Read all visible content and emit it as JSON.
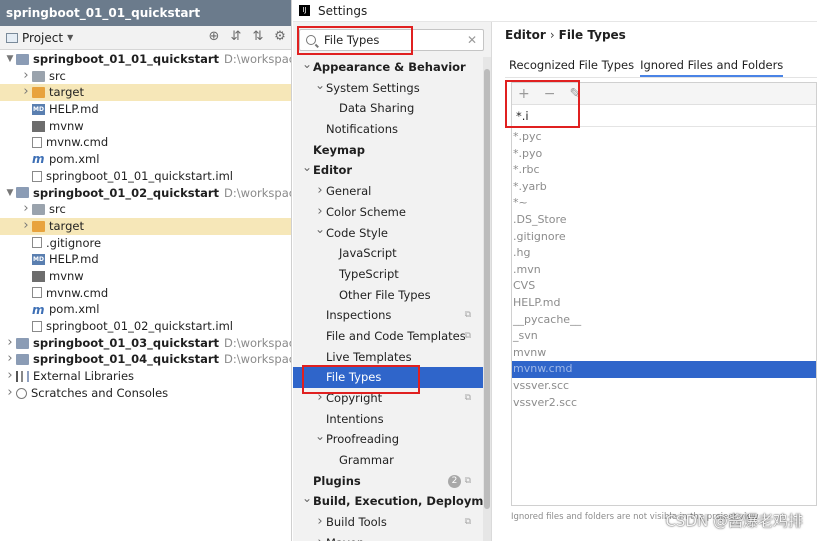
{
  "project_panel": {
    "title": "springboot_01_01_quickstart",
    "toolbar_label": "Project",
    "tree": [
      {
        "indent": 0,
        "arrow": "v",
        "icon": "module",
        "label": "springboot_01_01_quickstart",
        "bold": true,
        "path": "D:\\workspace\\spri"
      },
      {
        "indent": 1,
        "arrow": ">",
        "icon": "folder",
        "label": "src"
      },
      {
        "indent": 1,
        "arrow": ">",
        "icon": "folder-orange",
        "label": "target",
        "highlight": true
      },
      {
        "indent": 1,
        "arrow": "",
        "icon": "md",
        "label": "HELP.md"
      },
      {
        "indent": 1,
        "arrow": "",
        "icon": "mvnw",
        "label": "mvnw"
      },
      {
        "indent": 1,
        "arrow": "",
        "icon": "file",
        "label": "mvnw.cmd"
      },
      {
        "indent": 1,
        "arrow": "",
        "icon": "pom",
        "label": "pom.xml"
      },
      {
        "indent": 1,
        "arrow": "",
        "icon": "file",
        "label": "springboot_01_01_quickstart.iml"
      },
      {
        "indent": 0,
        "arrow": "v",
        "icon": "module",
        "label": "springboot_01_02_quickstart",
        "bold": true,
        "path": "D:\\workspace\\spri"
      },
      {
        "indent": 1,
        "arrow": ">",
        "icon": "folder",
        "label": "src"
      },
      {
        "indent": 1,
        "arrow": ">",
        "icon": "folder-orange",
        "label": "target",
        "highlight": true
      },
      {
        "indent": 1,
        "arrow": "",
        "icon": "file",
        "label": ".gitignore"
      },
      {
        "indent": 1,
        "arrow": "",
        "icon": "md",
        "label": "HELP.md"
      },
      {
        "indent": 1,
        "arrow": "",
        "icon": "mvnw",
        "label": "mvnw"
      },
      {
        "indent": 1,
        "arrow": "",
        "icon": "file",
        "label": "mvnw.cmd"
      },
      {
        "indent": 1,
        "arrow": "",
        "icon": "pom",
        "label": "pom.xml"
      },
      {
        "indent": 1,
        "arrow": "",
        "icon": "file",
        "label": "springboot_01_02_quickstart.iml"
      },
      {
        "indent": 0,
        "arrow": ">",
        "icon": "module",
        "label": "springboot_01_03_quickstart",
        "bold": true,
        "path": "D:\\workspace\\spri"
      },
      {
        "indent": 0,
        "arrow": ">",
        "icon": "module",
        "label": "springboot_01_04_quickstart",
        "bold": true,
        "path": "D:\\workspace\\spri"
      },
      {
        "indent": 0,
        "arrow": ">",
        "icon": "lib",
        "label": "External Libraries"
      },
      {
        "indent": 0,
        "arrow": ">",
        "icon": "scratch",
        "label": "Scratches and Consoles"
      }
    ]
  },
  "settings": {
    "title": "Settings",
    "search_value": "File Types",
    "nav": [
      {
        "indent": 0,
        "arrow": "v",
        "label": "Appearance & Behavior",
        "bold": true
      },
      {
        "indent": 1,
        "arrow": "v",
        "label": "System Settings"
      },
      {
        "indent": 2,
        "arrow": "",
        "label": "Data Sharing"
      },
      {
        "indent": 1,
        "arrow": "",
        "label": "Notifications"
      },
      {
        "indent": 0,
        "arrow": "",
        "label": "Keymap",
        "bold": true
      },
      {
        "indent": 0,
        "arrow": "v",
        "label": "Editor",
        "bold": true
      },
      {
        "indent": 1,
        "arrow": ">",
        "label": "General"
      },
      {
        "indent": 1,
        "arrow": ">",
        "label": "Color Scheme"
      },
      {
        "indent": 1,
        "arrow": "v",
        "label": "Code Style"
      },
      {
        "indent": 2,
        "arrow": "",
        "label": "JavaScript"
      },
      {
        "indent": 2,
        "arrow": "",
        "label": "TypeScript"
      },
      {
        "indent": 2,
        "arrow": "",
        "label": "Other File Types"
      },
      {
        "indent": 1,
        "arrow": "",
        "label": "Inspections",
        "badge": true
      },
      {
        "indent": 1,
        "arrow": "",
        "label": "File and Code Templates",
        "badge": true
      },
      {
        "indent": 1,
        "arrow": "",
        "label": "Live Templates"
      },
      {
        "indent": 1,
        "arrow": "",
        "label": "File Types",
        "selected": true
      },
      {
        "indent": 1,
        "arrow": ">",
        "label": "Copyright",
        "badge": true
      },
      {
        "indent": 1,
        "arrow": "",
        "label": "Intentions"
      },
      {
        "indent": 1,
        "arrow": "v",
        "label": "Proofreading"
      },
      {
        "indent": 2,
        "arrow": "",
        "label": "Grammar"
      },
      {
        "indent": 0,
        "arrow": "",
        "label": "Plugins",
        "bold": true,
        "count": "2",
        "badge": true
      },
      {
        "indent": 0,
        "arrow": "v",
        "label": "Build, Execution, Deployment",
        "bold": true
      },
      {
        "indent": 1,
        "arrow": ">",
        "label": "Build Tools",
        "badge": true
      },
      {
        "indent": 1,
        "arrow": ">",
        "label": "Maven"
      }
    ],
    "breadcrumb": [
      "Editor",
      "File Types"
    ],
    "tabs": [
      {
        "label": "Recognized File Types",
        "active": false
      },
      {
        "label": "Ignored Files and Folders",
        "active": true
      }
    ],
    "pattern_value": "*.i",
    "ignored": [
      "*.pyc",
      "*.pyo",
      "*.rbc",
      "*.yarb",
      "*~",
      ".DS_Store",
      ".gitignore",
      ".hg",
      ".mvn",
      "CVS",
      "HELP.md",
      "__pycache__",
      "_svn",
      "mvnw",
      "mvnw.cmd",
      "vssver.scc",
      "vssver2.scc"
    ],
    "ignored_selected_index": 14,
    "footer_note": "Ignored files and folders are not visible in the project view",
    "watermark": "CSDN @酱爆老鸡排"
  }
}
